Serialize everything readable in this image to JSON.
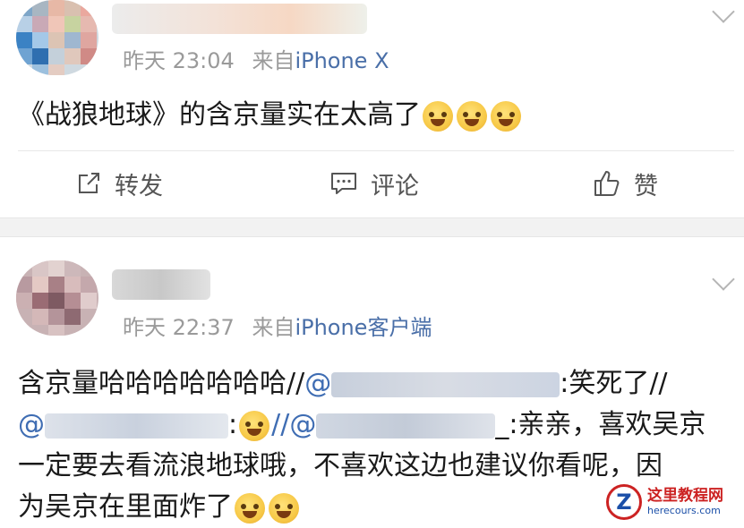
{
  "posts": [
    {
      "time": "昨天 23:04",
      "source_prefix": "来自",
      "source": "iPhone X",
      "text_main": "《战狼地球》的含京量实在太高了",
      "emoji_names": [
        "laugh-cry-icon",
        "laugh-cry-icon",
        "laugh-cry-icon"
      ],
      "actions": {
        "repost": "转发",
        "comment": "评论",
        "like": "赞"
      }
    },
    {
      "time": "昨天 22:37",
      "source_prefix": "来自",
      "source": "iPhone客户端",
      "line1_text": "含京量哈哈哈哈哈哈哈//",
      "line1_at": "@",
      "line1_after": ":笑死了//",
      "line2_at1": "@",
      "line2_sep": "//",
      "line2_at2": "@",
      "line2_after": "_:亲亲，喜欢吴京",
      "line3": "一定要去看流浪地球哦，不喜欢这边也建议你看呢，因",
      "line4": "为吴京在里面炸了"
    }
  ],
  "watermark": {
    "title": "这里教程网",
    "url": "herecours.com"
  },
  "colors": {
    "link": "#3f6db3",
    "meta": "#9a9a9a",
    "source": "#4a6fa8"
  }
}
